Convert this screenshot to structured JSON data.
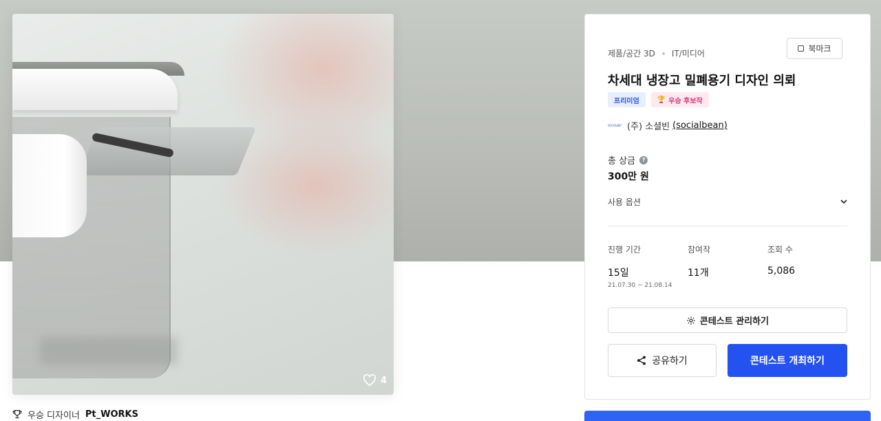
{
  "contest": {
    "category_primary": "제품/공간 3D",
    "category_secondary": "IT/미디어",
    "title": "차세대 냉장고 밀폐용기 디자인 의뢰",
    "badges": {
      "premium": "프리미엄",
      "winner": "우승 후보작"
    },
    "company": {
      "logo_text": "SOCIALBEAN",
      "name": "(주) 소셜빈",
      "handle": "(socialbean)"
    },
    "prize": {
      "label": "총 상금",
      "help": "?",
      "value": "300만 원"
    },
    "use_option_label": "사용 옵션",
    "stats": {
      "period_label": "진행 기간",
      "period_value": "15일",
      "period_range": "21.07.30 ~ 21.08.14",
      "entries_label": "참여작",
      "entries_value": "11개",
      "views_label": "조회 수",
      "views_value": "5,086"
    }
  },
  "actions": {
    "bookmark": "북마크",
    "manage": "콘테스트 관리하기",
    "share": "공유하기",
    "host": "콘테스트 개최하기"
  },
  "hero": {
    "likes": "4"
  },
  "designer": {
    "prefix": "우승 디자이너",
    "nickname": "Pt_WORKS"
  },
  "icons": {
    "heart": "heart-icon",
    "trophy": "trophy-icon",
    "gear": "gear-icon",
    "share": "share-icon",
    "chevron": "chevron-down-icon",
    "bookmark": "bookmark-icon"
  },
  "colors": {
    "primary": "#2452f0",
    "premium_badge_bg": "#e7eeff",
    "winner_badge_bg": "#fde9ef"
  }
}
